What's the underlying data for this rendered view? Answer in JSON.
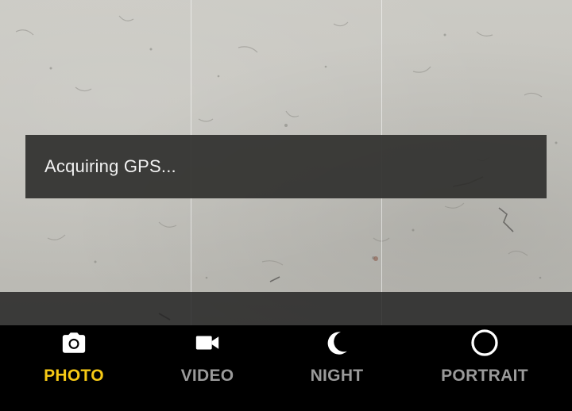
{
  "toast": {
    "message": "Acquiring GPS..."
  },
  "modes": [
    {
      "label": "PHOTO",
      "icon": "camera-icon",
      "active": true
    },
    {
      "label": "VIDEO",
      "icon": "video-camera-icon",
      "active": false
    },
    {
      "label": "NIGHT",
      "icon": "moon-icon",
      "active": false
    },
    {
      "label": "PORTRAIT",
      "icon": "circle-icon",
      "active": false
    }
  ],
  "colors": {
    "active_mode": "#f6c915",
    "inactive_mode": "#9a9a9a",
    "toast_background": "#30302e",
    "mode_bar_background": "#000000"
  }
}
